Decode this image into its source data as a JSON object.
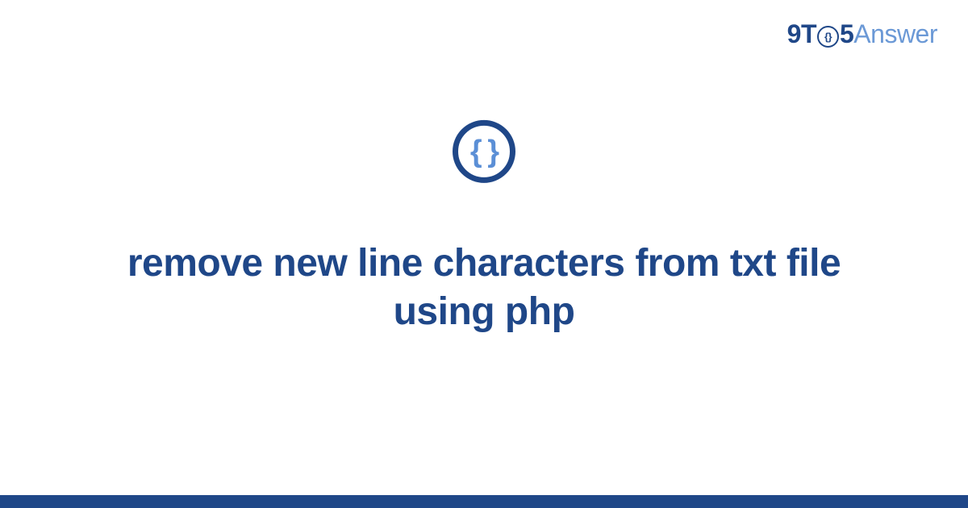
{
  "logo": {
    "part1": "9T",
    "circle": "{}",
    "part2": "5",
    "part3": "Answer"
  },
  "icon": {
    "glyph": "{ }"
  },
  "title": "remove new line characters from txt file using php",
  "colors": {
    "primary": "#1f4788",
    "accent": "#6b99d6"
  }
}
